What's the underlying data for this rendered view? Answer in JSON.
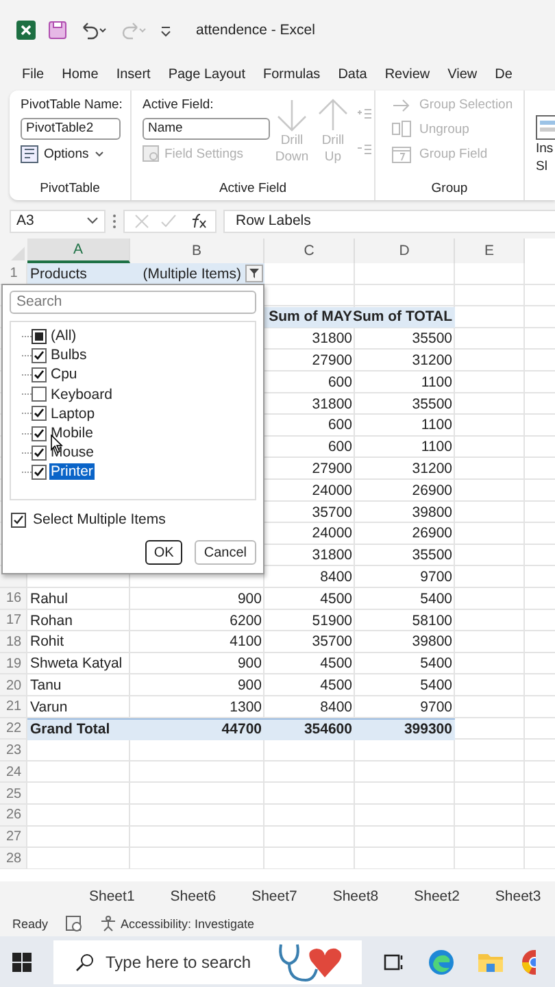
{
  "window": {
    "title": "attendence - Excel"
  },
  "menu": [
    {
      "label": "File"
    },
    {
      "label": "Home"
    },
    {
      "label": "Insert"
    },
    {
      "label": "Page Layout"
    },
    {
      "label": "Formulas"
    },
    {
      "label": "Data"
    },
    {
      "label": "Review"
    },
    {
      "label": "View"
    },
    {
      "label": "De"
    }
  ],
  "ribbon": {
    "pivot_name_label": "PivotTable Name:",
    "pivot_name": "PivotTable2",
    "options": "Options",
    "group1": "PivotTable",
    "active_field_label": "Active Field:",
    "active_field": "Name",
    "field_settings": {
      "label": "Field Settings",
      "disabled": true
    },
    "drill": [
      {
        "lines": [
          "Drill",
          "Down"
        ],
        "disabled": true,
        "kind": "down"
      },
      {
        "lines": [
          "Drill",
          "Up"
        ],
        "disabled": true,
        "kind": "up"
      }
    ],
    "group2": "Active Field",
    "group_items": [
      {
        "label": "Group Selection",
        "disabled": true,
        "kind": "arrow"
      },
      {
        "label": "Ungroup",
        "disabled": true,
        "kind": "ungroup"
      },
      {
        "label": "Group Field",
        "disabled": true,
        "kind": "field"
      }
    ],
    "group3": "Group",
    "cut_lines": [
      "Ins",
      "Sl"
    ]
  },
  "formula_bar": {
    "name_box": "A3",
    "content": "Row Labels"
  },
  "columns": [
    {
      "label": "A",
      "selected": true
    },
    {
      "label": "B",
      "selected": false
    },
    {
      "label": "C",
      "selected": false
    },
    {
      "label": "D",
      "selected": false
    },
    {
      "label": "E",
      "selected": false
    }
  ],
  "rows": [
    {
      "num": "1",
      "kind": "filter",
      "a": "Products",
      "b": "(Multiple Items)"
    },
    {
      "kind": "data"
    },
    {
      "kind": "header",
      "c": "Sum of MAY",
      "d": "Sum of TOTAL"
    },
    {
      "kind": "data",
      "c": "31800",
      "d": "35500"
    },
    {
      "kind": "data",
      "c": "27900",
      "d": "31200"
    },
    {
      "kind": "data",
      "c": "600",
      "d": "1100"
    },
    {
      "kind": "data",
      "c": "31800",
      "d": "35500"
    },
    {
      "kind": "data",
      "c": "600",
      "d": "1100"
    },
    {
      "kind": "data",
      "c": "600",
      "d": "1100"
    },
    {
      "kind": "data",
      "c": "27900",
      "d": "31200"
    },
    {
      "kind": "data",
      "c": "24000",
      "d": "26900"
    },
    {
      "kind": "data",
      "c": "35700",
      "d": "39800"
    },
    {
      "kind": "data",
      "c": "24000",
      "d": "26900"
    },
    {
      "kind": "data",
      "c": "31800",
      "d": "35500"
    },
    {
      "kind": "data",
      "c": "8400",
      "d": "9700"
    },
    {
      "num": "16",
      "kind": "data",
      "a": "Rahul",
      "b": "900",
      "c": "4500",
      "d": "5400"
    },
    {
      "num": "17",
      "kind": "data",
      "a": "Rohan",
      "b": "6200",
      "c": "51900",
      "d": "58100"
    },
    {
      "num": "18",
      "kind": "data",
      "a": "Rohit",
      "b": "4100",
      "c": "35700",
      "d": "39800"
    },
    {
      "num": "19",
      "kind": "data",
      "a": "Shweta Katyal",
      "b": "900",
      "c": "4500",
      "d": "5400"
    },
    {
      "num": "20",
      "kind": "data",
      "a": "Tanu",
      "b": "900",
      "c": "4500",
      "d": "5400"
    },
    {
      "num": "21",
      "kind": "data",
      "a": "Varun",
      "b": "1300",
      "c": "8400",
      "d": "9700"
    },
    {
      "num": "22",
      "kind": "total",
      "a": "Grand Total",
      "b": "44700",
      "c": "354600",
      "d": "399300"
    },
    {
      "num": "23",
      "kind": "data"
    },
    {
      "num": "24",
      "kind": "data"
    },
    {
      "num": "25",
      "kind": "data"
    },
    {
      "num": "26",
      "kind": "data"
    },
    {
      "num": "27",
      "kind": "data"
    },
    {
      "num": "28",
      "kind": "data"
    }
  ],
  "filter_dialog": {
    "search_placeholder": "Search",
    "items": [
      {
        "label": "(All)",
        "kind": "all",
        "checked": true,
        "selected": false
      },
      {
        "label": "Bulbs",
        "kind": "item",
        "checked": true,
        "selected": false
      },
      {
        "label": "Cpu",
        "kind": "item",
        "checked": true,
        "selected": false
      },
      {
        "label": "Keyboard",
        "kind": "item",
        "checked": false,
        "selected": false
      },
      {
        "label": "Laptop",
        "kind": "item",
        "checked": true,
        "selected": false
      },
      {
        "label": "Mobile",
        "kind": "item",
        "checked": true,
        "selected": false
      },
      {
        "label": "Mouse",
        "kind": "item",
        "checked": true,
        "selected": false
      },
      {
        "label": "Printer",
        "kind": "item",
        "checked": true,
        "selected": true
      }
    ],
    "select_multiple": {
      "label": "Select Multiple Items",
      "checked": true
    },
    "buttons": [
      "OK",
      "Cancel"
    ]
  },
  "sheet_tabs": [
    {
      "label": "Sheet1"
    },
    {
      "label": "Sheet6"
    },
    {
      "label": "Sheet7"
    },
    {
      "label": "Sheet8"
    },
    {
      "label": "Sheet2"
    },
    {
      "label": "Sheet3"
    }
  ],
  "status_bar": {
    "status": "Ready",
    "accessibility": "Accessibility: Investigate"
  },
  "taskbar": {
    "search_placeholder": "Type here to search"
  }
}
